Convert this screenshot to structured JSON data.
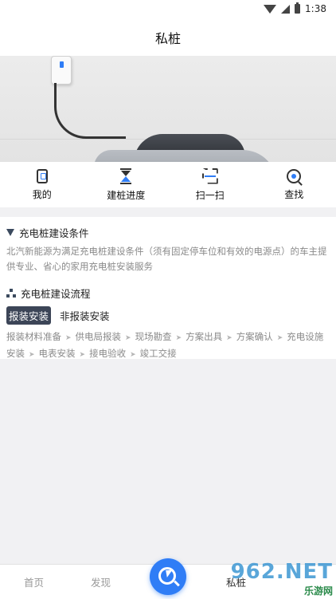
{
  "status_bar": {
    "time": "1:38"
  },
  "header": {
    "title": "私桩"
  },
  "quick_actions": [
    {
      "label": "我的",
      "icon": "charging-station-icon"
    },
    {
      "label": "建桩进度",
      "icon": "hourglass-icon"
    },
    {
      "label": "扫一扫",
      "icon": "scan-icon"
    },
    {
      "label": "查找",
      "icon": "search-icon"
    }
  ],
  "conditions": {
    "title": "充电桩建设条件",
    "description": "北汽新能源为满足充电桩建设条件（须有固定停车位和有效的电源点）的车主提供专业、省心的家用充电桩安装服务"
  },
  "process": {
    "title": "充电桩建设流程",
    "tabs": [
      "报装安装",
      "非报装安装"
    ],
    "active_tab": "报装安装",
    "steps": [
      "报装材料准备",
      "供电局报装",
      "现场勘查",
      "方案出具",
      "方案确认",
      "充电设施安装",
      "电表安装",
      "接电验收",
      "竣工交接"
    ]
  },
  "bottom_nav": {
    "home": "首页",
    "discover": "发现",
    "private": "私桩"
  },
  "watermark": {
    "big": "962.NET",
    "small": "乐游网"
  },
  "colors": {
    "accent": "#2f7df6",
    "tab_active": "#3c4557"
  }
}
